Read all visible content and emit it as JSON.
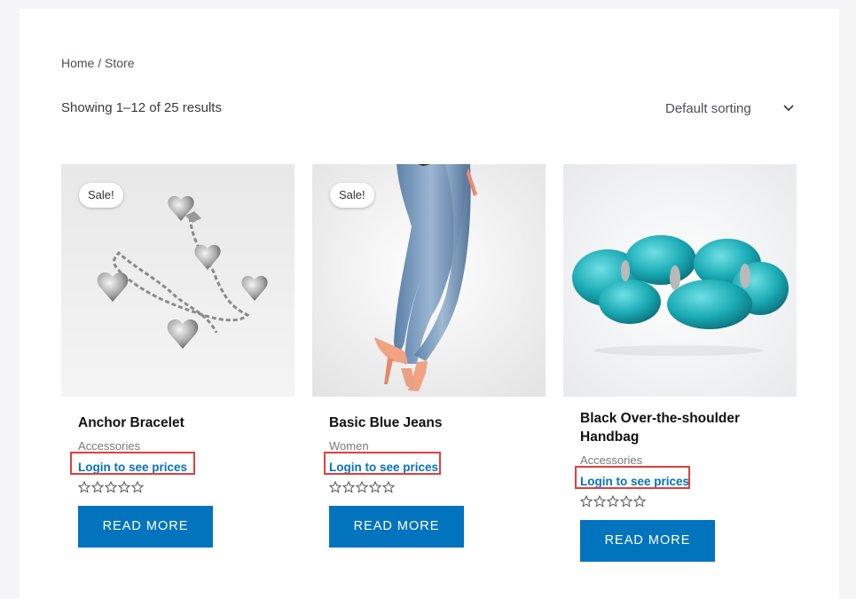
{
  "breadcrumb": {
    "home": "Home",
    "sep": " / ",
    "current": "Store"
  },
  "results_text": "Showing 1–12 of 25 results",
  "sorting": {
    "selected": "Default sorting"
  },
  "colors": {
    "accent": "#0274be",
    "highlight": "#e0403a"
  },
  "products": [
    {
      "title": "Anchor Bracelet",
      "category": "Accessories",
      "sale_badge": "Sale!",
      "login_text": "Login to see prices",
      "button": "READ MORE",
      "rating": 0,
      "image_icon": "silver-heart-charm-bracelet"
    },
    {
      "title": "Basic Blue Jeans",
      "category": "Women",
      "sale_badge": "Sale!",
      "login_text": "Login to see prices",
      "button": "READ MORE",
      "rating": 0,
      "image_icon": "blue-jeans-legs"
    },
    {
      "title": "Black Over-the-shoulder Handbag",
      "category": "Accessories",
      "login_text": "Login to see prices",
      "button": "READ MORE",
      "rating": 0,
      "image_icon": "turquoise-stone-bracelet"
    }
  ]
}
